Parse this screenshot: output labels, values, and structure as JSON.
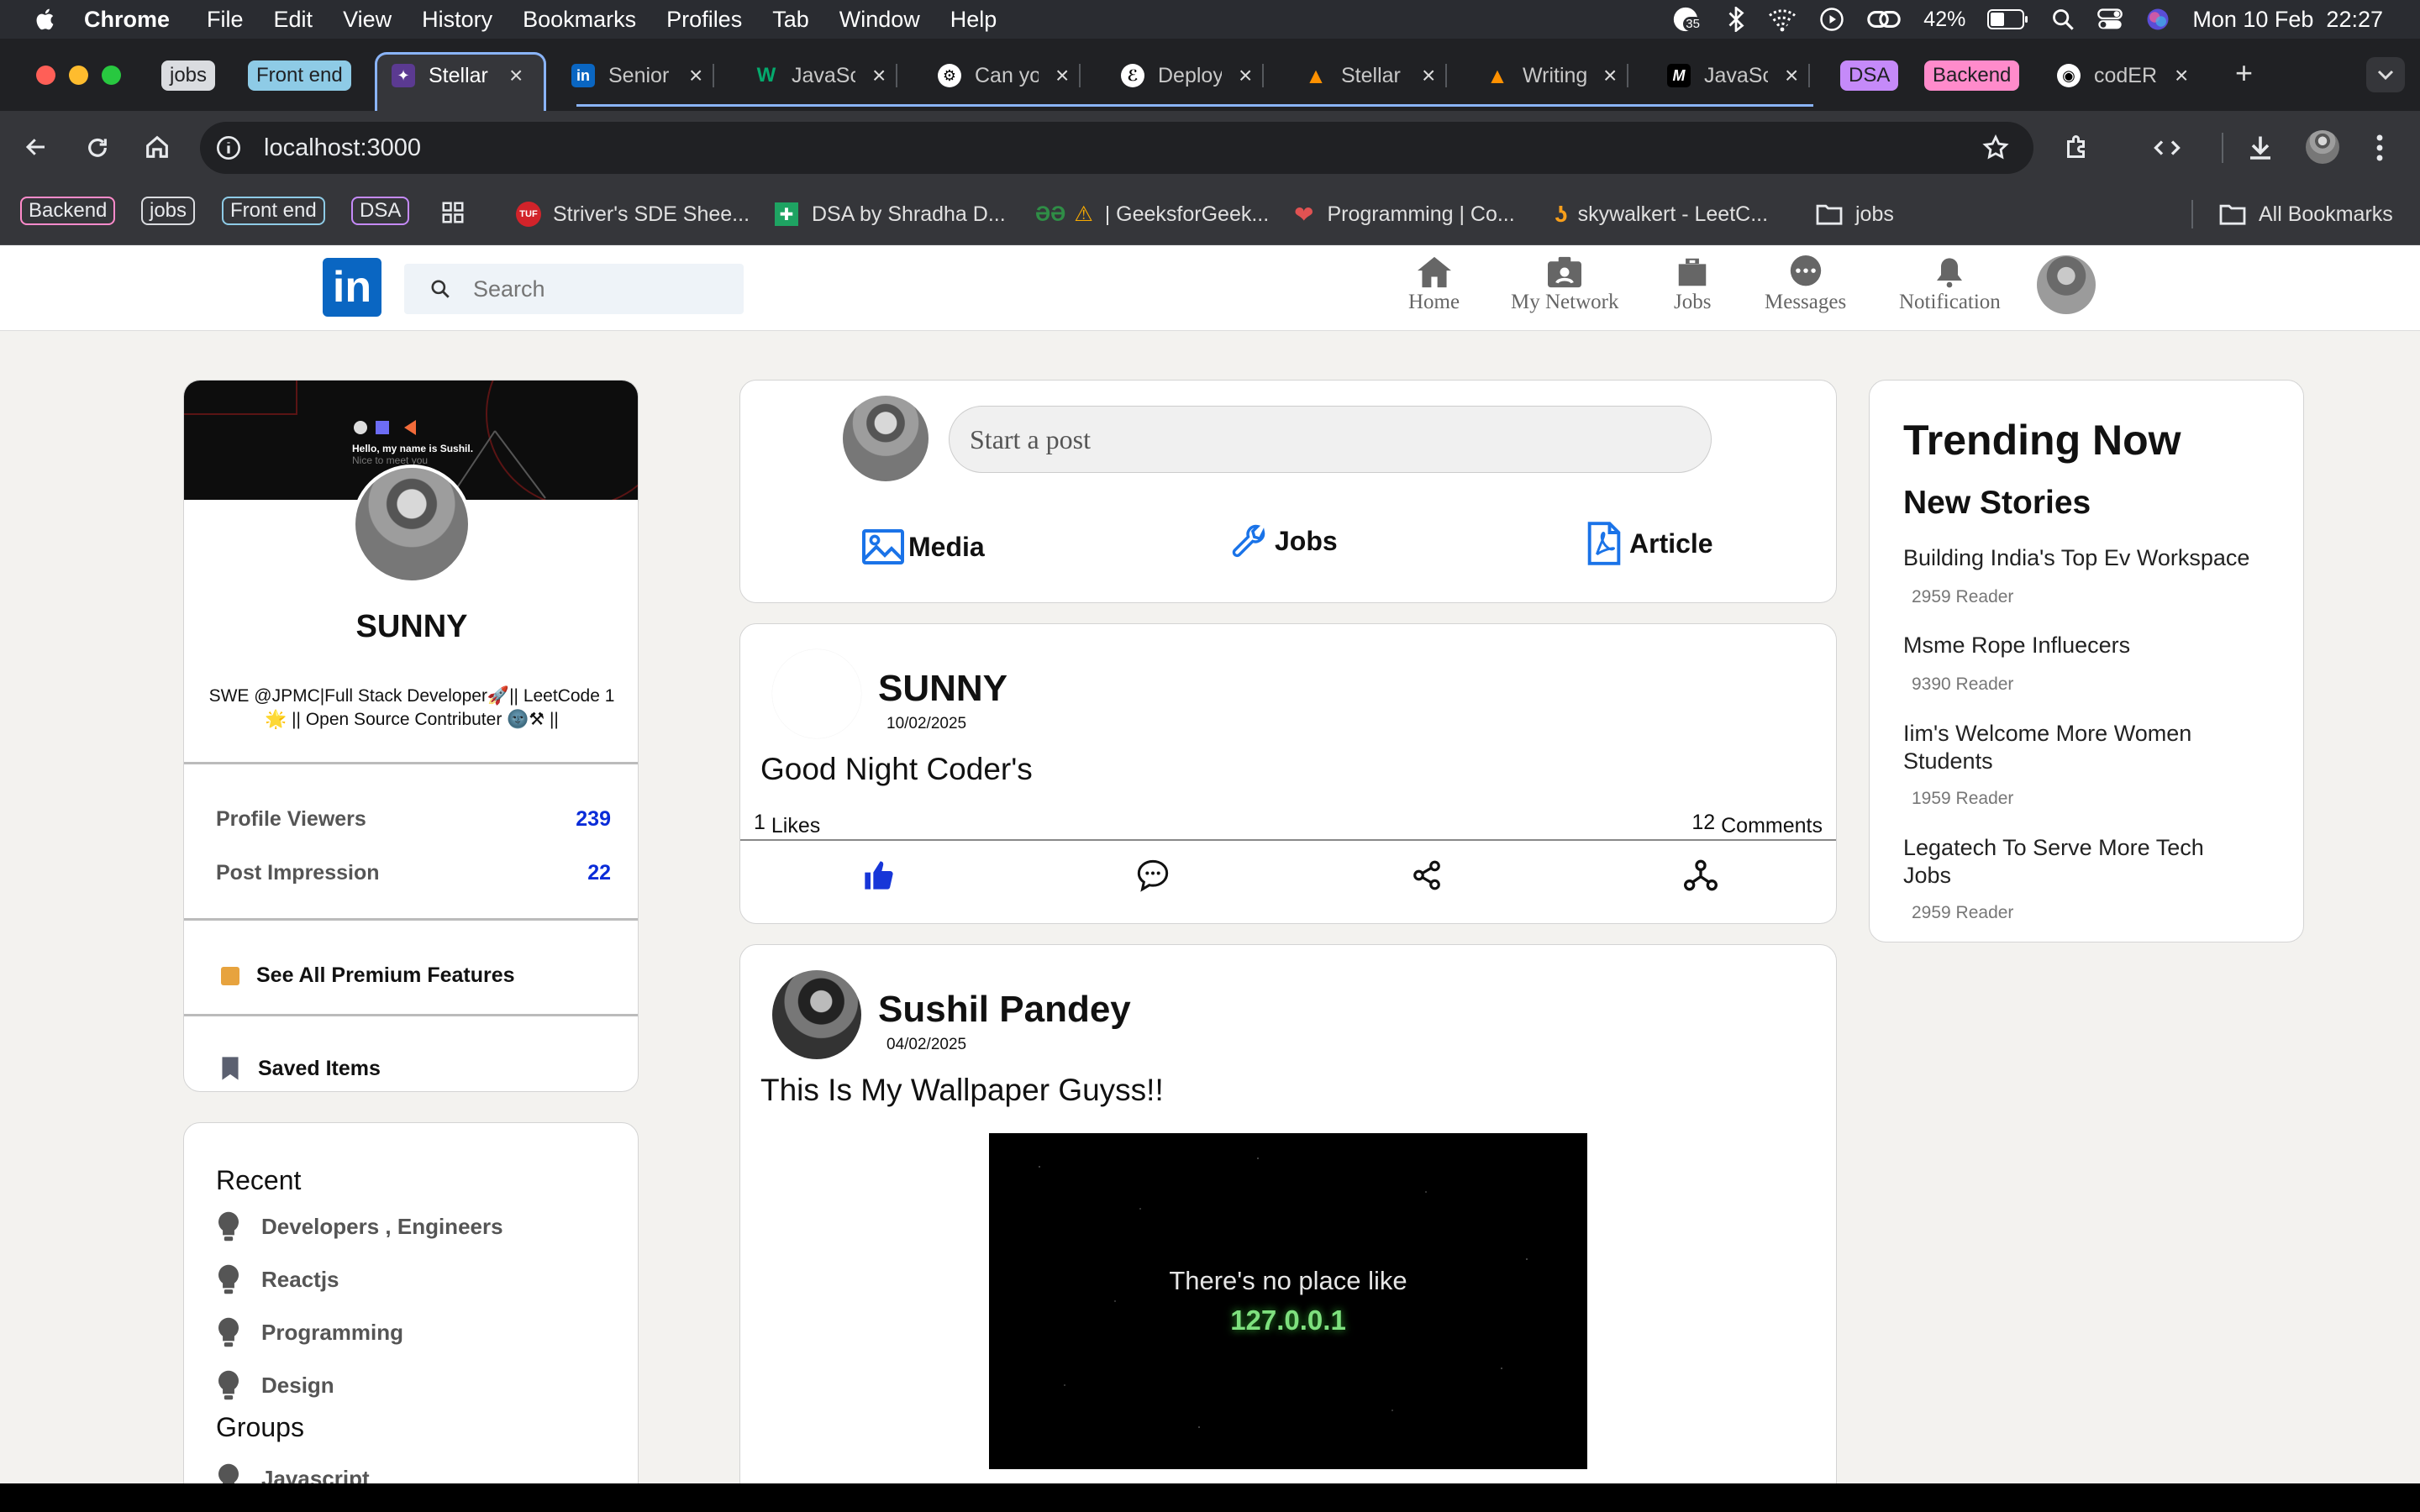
{
  "menubar": {
    "app": "Chrome",
    "items": [
      "File",
      "Edit",
      "View",
      "History",
      "Bookmarks",
      "Profiles",
      "Tab",
      "Window",
      "Help"
    ],
    "notification_badge": "35",
    "battery": "42%",
    "datetime": "Mon 10 Feb  22:27"
  },
  "tab_groups": {
    "jobs": "jobs",
    "front_end": "Front end",
    "dsa": "DSA",
    "backend": "Backend"
  },
  "tabs": [
    {
      "label": "Stellar",
      "icon": "app-favicon"
    },
    {
      "label": "Senior",
      "icon": "linkedin-favicon"
    },
    {
      "label": "JavaSc",
      "icon": "w3schools-favicon"
    },
    {
      "label": "Can yo",
      "icon": "chatgpt-favicon"
    },
    {
      "label": "Deploy",
      "icon": "render-favicon"
    },
    {
      "label": "Stellar",
      "icon": "firebase-favicon"
    },
    {
      "label": "Writing",
      "icon": "firebase-favicon"
    },
    {
      "label": "JavaSc",
      "icon": "medium-favicon"
    },
    {
      "label": "codER",
      "icon": "github-favicon"
    }
  ],
  "address_bar": {
    "url": "localhost:3000"
  },
  "bookmarks": {
    "chips": [
      "Backend",
      "jobs",
      "Front end",
      "DSA"
    ],
    "items": [
      "Striver's SDE Shee...",
      "DSA by Shradha D...",
      "| GeeksforGeek...",
      "Programming | Co...",
      "skywalkert - LeetC...",
      "jobs"
    ],
    "all": "All Bookmarks"
  },
  "colors": {
    "linkedin_blue": "#0a66c2",
    "stat_blue": "#0a2cd8",
    "chip_blue": "#8ecbe6",
    "chip_purple": "#c58af9",
    "chip_pink": "#ff8bcb",
    "chip_grey": "#dadce0"
  },
  "nav": {
    "logo": "in",
    "search_placeholder": "Search",
    "items": [
      "Home",
      "My Network",
      "Jobs",
      "Messages",
      "Notification"
    ]
  },
  "profile": {
    "banner_text": "Hello, my name is Sushil.",
    "banner_subtext": "Nice to meet you",
    "name": "SUNNY",
    "headline": "SWE @JPMC|Full Stack Developer🚀|| LeetCode 1 🌟 || Open Source Contributer 🌚⚒ ||",
    "stats": [
      {
        "label": "Profile Viewers",
        "value": "239"
      },
      {
        "label": "Post Impression",
        "value": "22"
      }
    ],
    "premium": "See All Premium Features",
    "saved": "Saved Items"
  },
  "recent": {
    "title": "Recent",
    "items": [
      "Developers , Engineers",
      "Reactjs",
      "Programming",
      "Design"
    ],
    "groups_title": "Groups",
    "groups": [
      "Javascript"
    ]
  },
  "composer": {
    "placeholder": "Start a post",
    "actions": [
      "Media",
      "Jobs",
      "Article"
    ]
  },
  "posts": [
    {
      "author": "SUNNY",
      "date": "10/02/2025",
      "text": "Good Night Coder's",
      "likes": "1",
      "likes_label": "Likes",
      "comments": "12",
      "comments_label": "Comments"
    },
    {
      "author": "Sushil Pandey",
      "date": "04/02/2025",
      "text": "This Is My Wallpaper Guyss!!",
      "image_line1": "There's no place like",
      "image_line2": "127.0.0.1"
    }
  ],
  "trending": {
    "title": "Trending Now",
    "subtitle": "New Stories",
    "stories": [
      {
        "title": "Building India's Top Ev Workspace",
        "readers": "2959 Reader"
      },
      {
        "title": "Msme Rope Influecers",
        "readers": "9390 Reader"
      },
      {
        "title": "Iim's Welcome More Women Students",
        "readers": "1959 Reader"
      },
      {
        "title": "Legatech To Serve More Tech Jobs",
        "readers": "2959 Reader"
      }
    ]
  }
}
